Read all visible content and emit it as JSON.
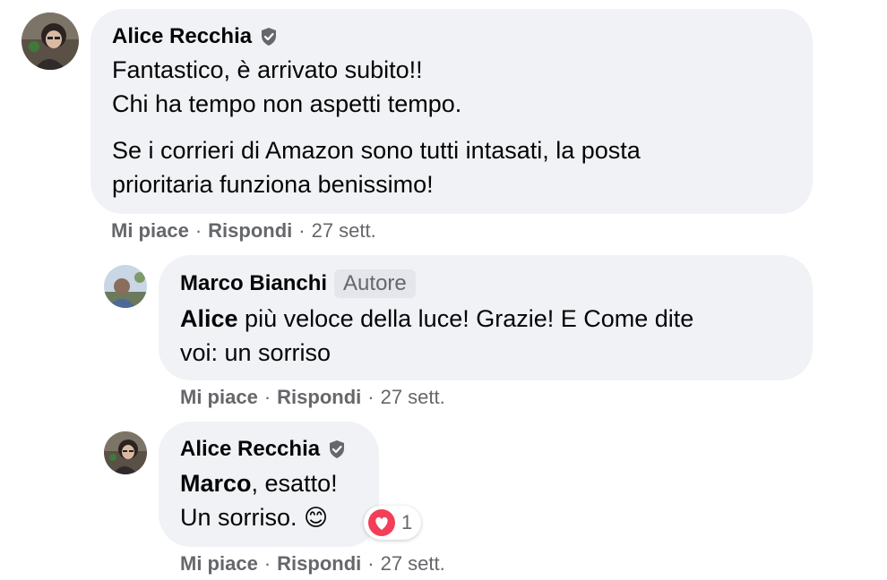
{
  "colors": {
    "bubble_bg": "#f0f2f5",
    "meta_text": "#65676b",
    "text": "#050505",
    "reaction_heart": "#f33e58",
    "badge_bg": "#e4e6eb"
  },
  "comments": [
    {
      "author": "Alice Recchia",
      "verified_icon": "shield-check-icon",
      "lines": [
        "Fantastico, è arrivato subito!!",
        "Chi ha tempo non aspetti tempo."
      ],
      "paragraph2": [
        "Se i corrieri di Amazon sono tutti intasati, la posta",
        "prioritaria funziona benissimo!"
      ],
      "actions": {
        "like": "Mi piace",
        "reply": "Rispondi",
        "time": "27 sett."
      }
    }
  ],
  "replies": [
    {
      "author": "Marco Bianchi",
      "badge": "Autore",
      "mention": "Alice",
      "line1_rest": " più veloce della luce! Grazie! E Come dite",
      "line2": "voi: un sorriso",
      "actions": {
        "like": "Mi piace",
        "reply": "Rispondi",
        "time": "27 sett."
      }
    },
    {
      "author": "Alice Recchia",
      "verified_icon": "shield-check-icon",
      "mention": "Marco",
      "line1_rest": ", esatto!",
      "line2": "Un sorriso. ",
      "emoji": "😊",
      "reaction": {
        "icon": "heart-reaction-icon",
        "count": "1"
      },
      "actions": {
        "like": "Mi piace",
        "reply": "Rispondi",
        "time": "27 sett."
      }
    }
  ],
  "separator": "·"
}
